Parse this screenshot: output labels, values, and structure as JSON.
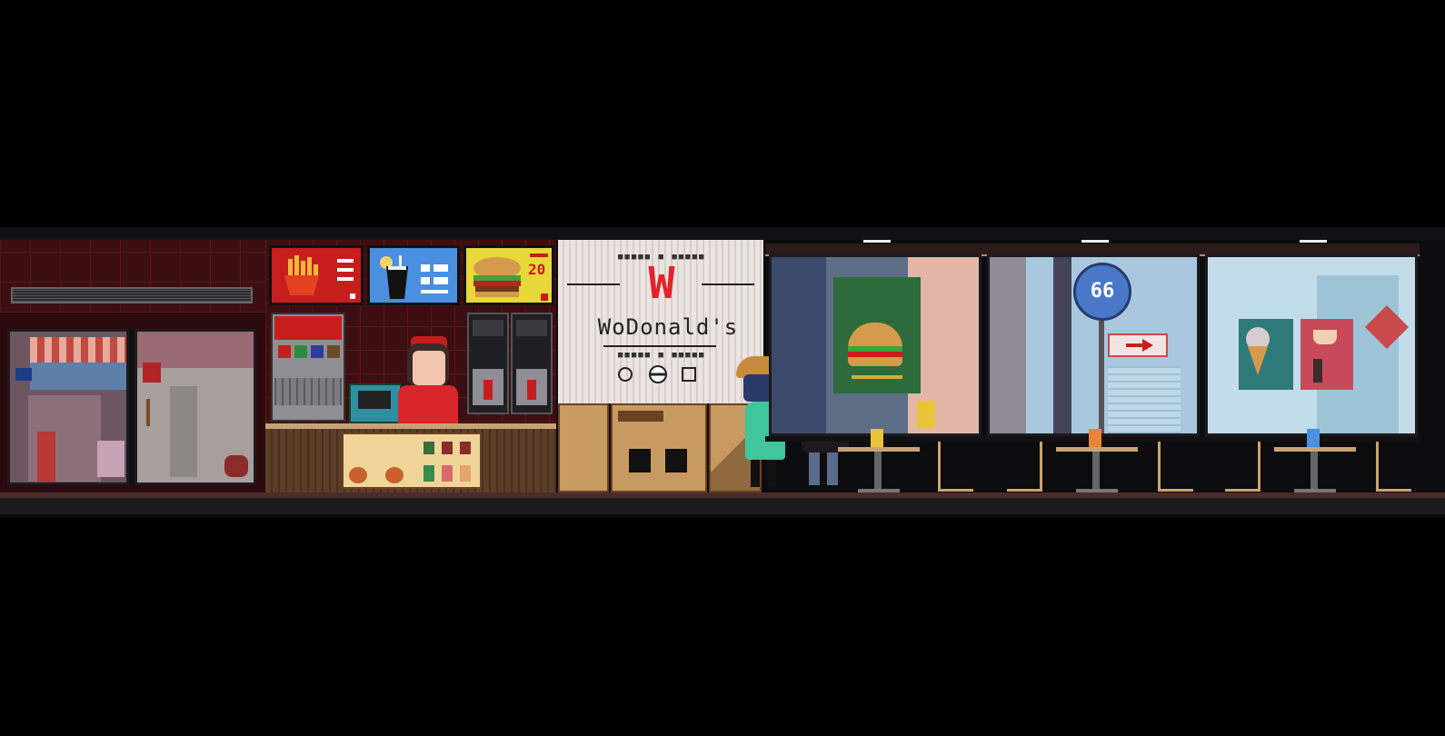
{
  "store": {
    "brand_name": "WoDonald's",
    "logo_letter": "W",
    "menu_price": "20",
    "bus_stop_number": "66"
  },
  "colors": {
    "brand_red": "#c81d1d",
    "menu_blue": "#4a8fe0",
    "menu_yellow": "#e8d83a",
    "wall_dark_red": "#3a0d10",
    "poster_green": "#2e6b3c",
    "sky_blue": "#a9c8df",
    "wood": "#c79a62"
  },
  "icons": [
    "fries-icon",
    "soda-cup-icon",
    "burger-icon",
    "ice-cream-icon",
    "coffee-icon",
    "arrow-right-icon"
  ]
}
